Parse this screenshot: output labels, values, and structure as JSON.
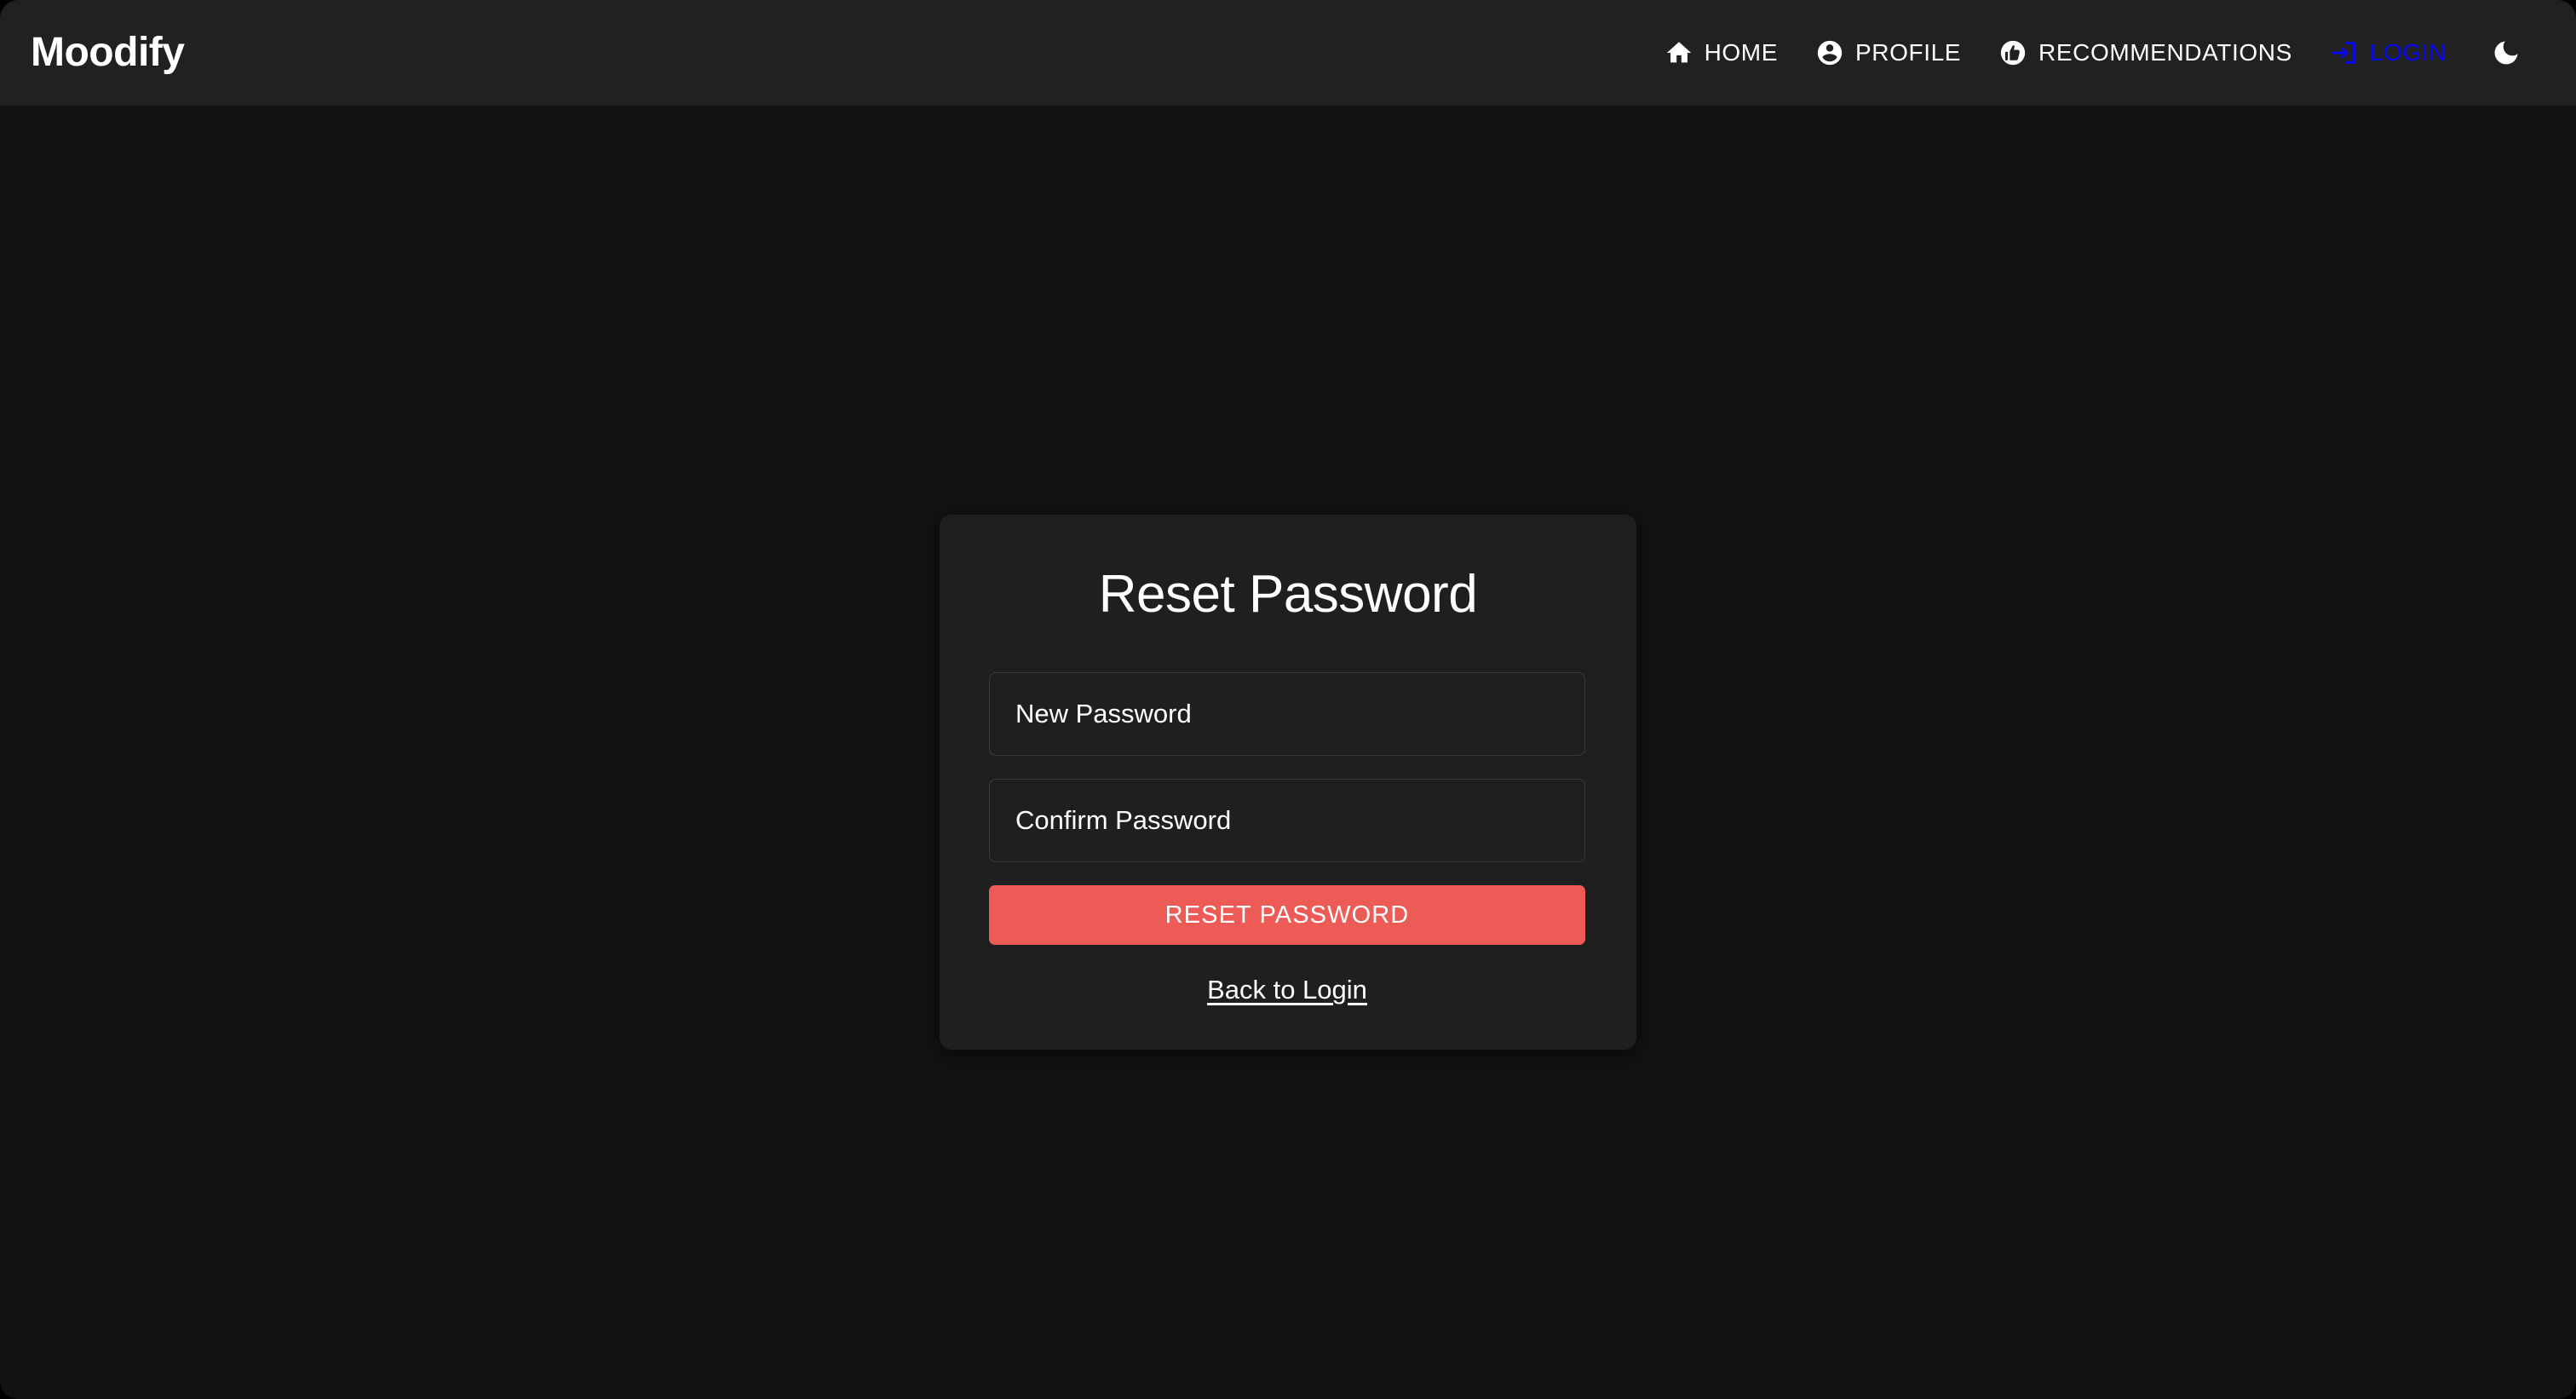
{
  "app": {
    "brand": "Moodify",
    "accent_color": "#0808f5",
    "primary_button_color": "#ec5b55",
    "navbar_bg": "#212121",
    "page_bg": "#121212",
    "card_bg": "#1f1f1f"
  },
  "navbar": {
    "items": [
      {
        "label": "HOME",
        "icon": "home-icon",
        "active": false
      },
      {
        "label": "PROFILE",
        "icon": "account-circle-icon",
        "active": false
      },
      {
        "label": "RECOMMENDATIONS",
        "icon": "thumb-up-circle-icon",
        "active": false
      },
      {
        "label": "LOGIN",
        "icon": "login-arrow-icon",
        "active": true
      }
    ],
    "theme_toggle": {
      "icon": "moon-icon",
      "mode": "dark"
    }
  },
  "card": {
    "title": "Reset Password",
    "fields": [
      {
        "name": "new-password",
        "label": "New Password",
        "placeholder": "New Password",
        "value": "",
        "type": "password"
      },
      {
        "name": "confirm-password",
        "label": "Confirm Password",
        "placeholder": "Confirm Password",
        "value": "",
        "type": "password"
      }
    ],
    "submit_label": "RESET PASSWORD",
    "back_link_label": "Back to Login"
  }
}
